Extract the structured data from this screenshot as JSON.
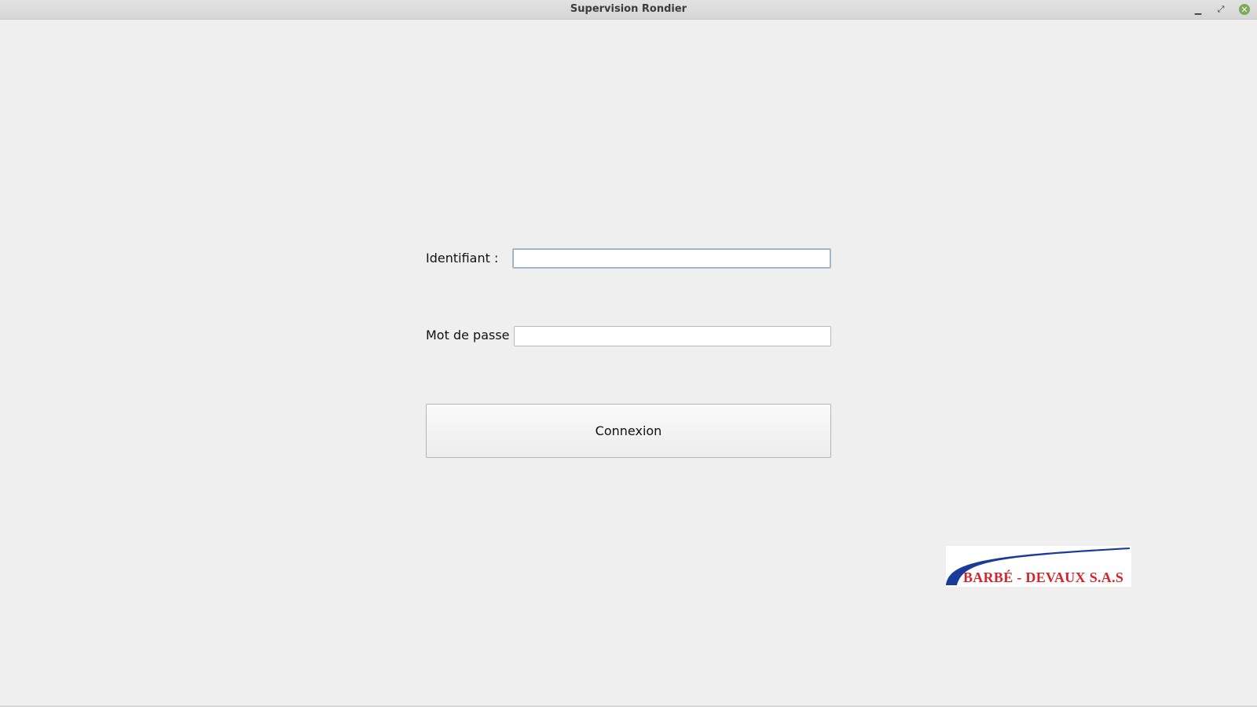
{
  "window": {
    "title": "Supervision Rondier",
    "controls": {
      "minimize_icon": "minimize-icon",
      "maximize_icon": "maximize-icon",
      "close_icon": "close-icon"
    }
  },
  "form": {
    "username_label": "Identifiant :",
    "username_value": "",
    "password_label": "Mot de passe :",
    "password_value": "",
    "submit_label": "Connexion"
  },
  "logo": {
    "text": "BARBÉ - DEVAUX S.A.S",
    "swoosh_color": "#1a3b9c",
    "text_color": "#d9232a"
  }
}
